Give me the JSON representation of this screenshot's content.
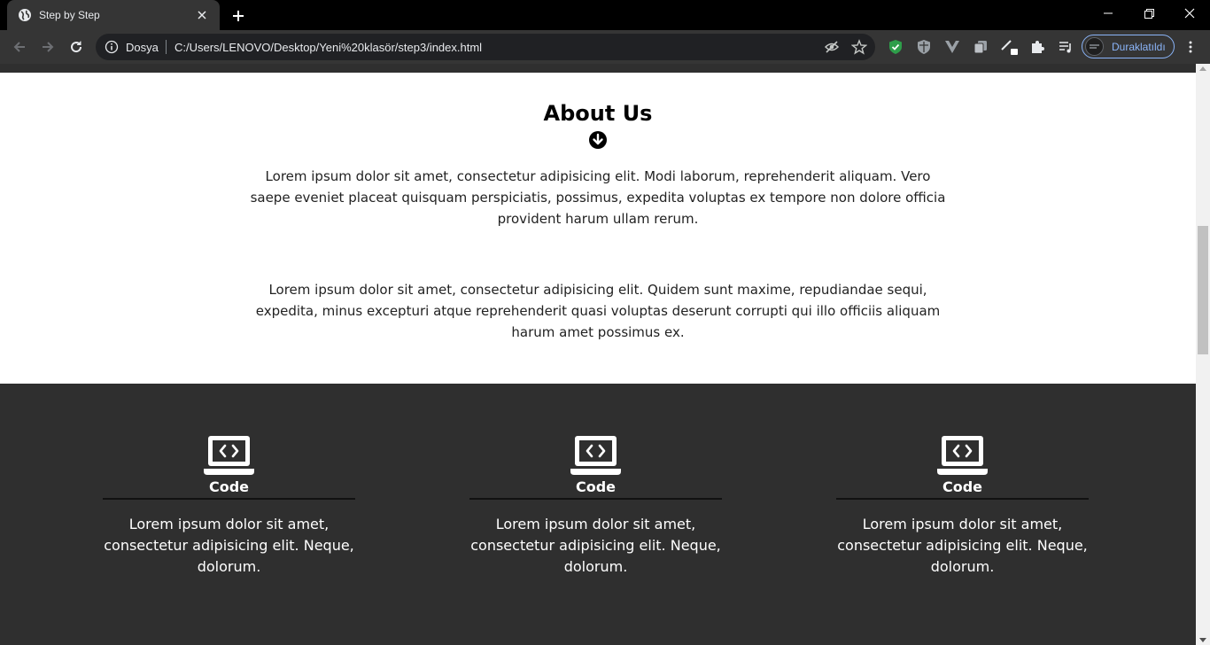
{
  "browser": {
    "tab": {
      "title": "Step by Step"
    },
    "address": {
      "security_label": "Dosya",
      "url": "C:/Users/LENOVO/Desktop/Yeni%20klasör/step3/index.html"
    },
    "profile": {
      "label": "Duraklatıldı"
    }
  },
  "page": {
    "about": {
      "title": "About Us",
      "paragraph1": "Lorem ipsum dolor sit amet, consectetur adipisicing elit. Modi laborum, reprehenderit aliquam. Vero saepe eveniet placeat quisquam perspiciatis, possimus, expedita voluptas ex tempore non dolore officia provident harum ullam rerum.",
      "paragraph2": "Lorem ipsum dolor sit amet, consectetur adipisicing elit. Quidem sunt maxime, repudiandae sequi, expedita, minus excepturi atque reprehenderit quasi voluptas deserunt corrupti qui illo officiis aliquam harum amet possimus ex."
    },
    "features": [
      {
        "icon": "laptop-code-icon",
        "title": "Code",
        "text": "Lorem ipsum dolor sit amet, consectetur adipisicing elit. Neque, dolorum."
      },
      {
        "icon": "laptop-code-icon",
        "title": "Code",
        "text": "Lorem ipsum dolor sit amet, consectetur adipisicing elit. Neque, dolorum."
      },
      {
        "icon": "laptop-code-icon",
        "title": "Code",
        "text": "Lorem ipsum dolor sit amet, consectetur adipisicing elit. Neque, dolorum."
      }
    ]
  },
  "colors": {
    "dark_section": "#2f2f2f",
    "profile_accent": "#8ab4f8"
  }
}
